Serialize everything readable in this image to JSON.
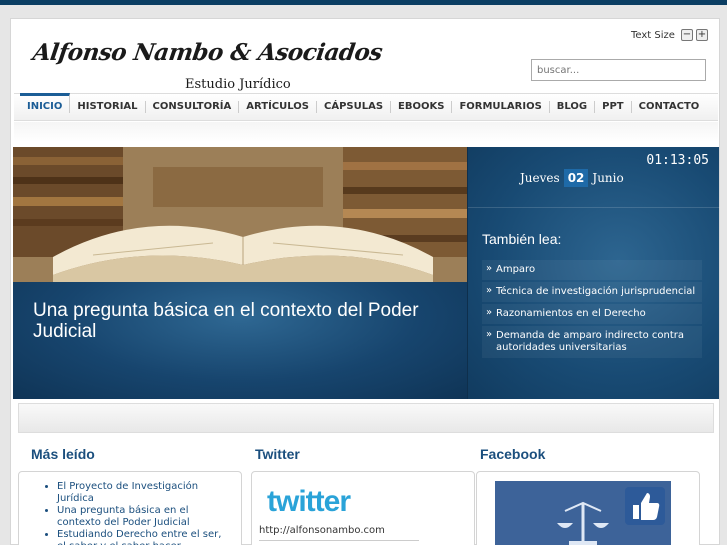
{
  "header": {
    "logo_main": "Alfonso Nambo & Asociados",
    "logo_sub": "Estudio Jurídico",
    "text_size_label": "Text Size",
    "text_size_decrease": "−",
    "text_size_increase": "+"
  },
  "search": {
    "placeholder": "buscar..."
  },
  "nav": {
    "items": [
      "INICIO",
      "HISTORIAL",
      "CONSULTORÍA",
      "ARTÍCULOS",
      "CÁPSULAS",
      "EBOOKS",
      "FORMULARIOS",
      "BLOG",
      "PPT",
      "CONTACTO"
    ],
    "active": "INICIO"
  },
  "slider": {
    "title": "Una pregunta básica en el contexto del Poder Judicial"
  },
  "sidebar": {
    "clock": "01:13:05",
    "day_name": "Jueves",
    "day_number": "02",
    "month": "Junio",
    "also_read_title": "También lea:",
    "also_read": [
      "Amparo",
      "Técnica de investigación jurisprudencial",
      "Razonamientos en el Derecho",
      "Demanda de amparo indirecto contra autoridades universitarias"
    ]
  },
  "columns": {
    "most_read_title": "Más leído",
    "most_read": [
      "El Proyecto de Investigación Jurídica",
      "Una pregunta básica en el contexto del Poder Judicial",
      "Estudiando Derecho entre el ser, el saber y el saber hacer"
    ],
    "twitter_title": "Twitter",
    "twitter_logo": "twitter",
    "twitter_url": "http://alfonsonambo.com",
    "facebook_title": "Facebook"
  },
  "colors": {
    "brand_dark": "#0b3e63",
    "accent": "#1b5d96",
    "date_highlight": "#1e6aa8",
    "twitter": "#2aa3d8"
  }
}
